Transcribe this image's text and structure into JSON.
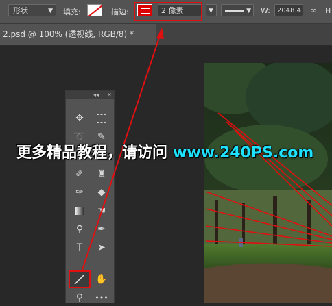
{
  "options_bar": {
    "mode_select": "形状",
    "fill_label": "填充:",
    "stroke_label": "描边:",
    "stroke_width_value": "2 像素",
    "width_label": "W:",
    "width_value": "2048.4"
  },
  "document_tab": {
    "title": "2.psd @ 100% (透视线, RGB/8) *"
  },
  "tools_panel": {
    "collapse_glyph": "◂◂",
    "close_glyph": "✕",
    "more_glyph": "•••",
    "type_tool_glyph": "T",
    "tools": [
      "move-icon",
      "marquee-icon",
      "lasso-icon",
      "quick-select-icon",
      "eyedropper-icon",
      "healing-icon",
      "brush-icon",
      "stamp-icon",
      "history-brush-icon",
      "eraser-icon",
      "gradient-icon",
      "smudge-icon",
      "dodge-icon",
      "pen-icon",
      "type-icon",
      "path-select-icon",
      "line-icon",
      "hand-icon",
      "zoom-icon",
      "more-icon"
    ],
    "active_tool": "line-icon"
  },
  "watermark": {
    "text_cn": "更多精品教程，请访问",
    "text_url": "www.240PS.com"
  },
  "colors": {
    "annotation_red": "#e01010",
    "watermark_cyan": "#1ee0ff",
    "ui_panel": "#535353"
  }
}
